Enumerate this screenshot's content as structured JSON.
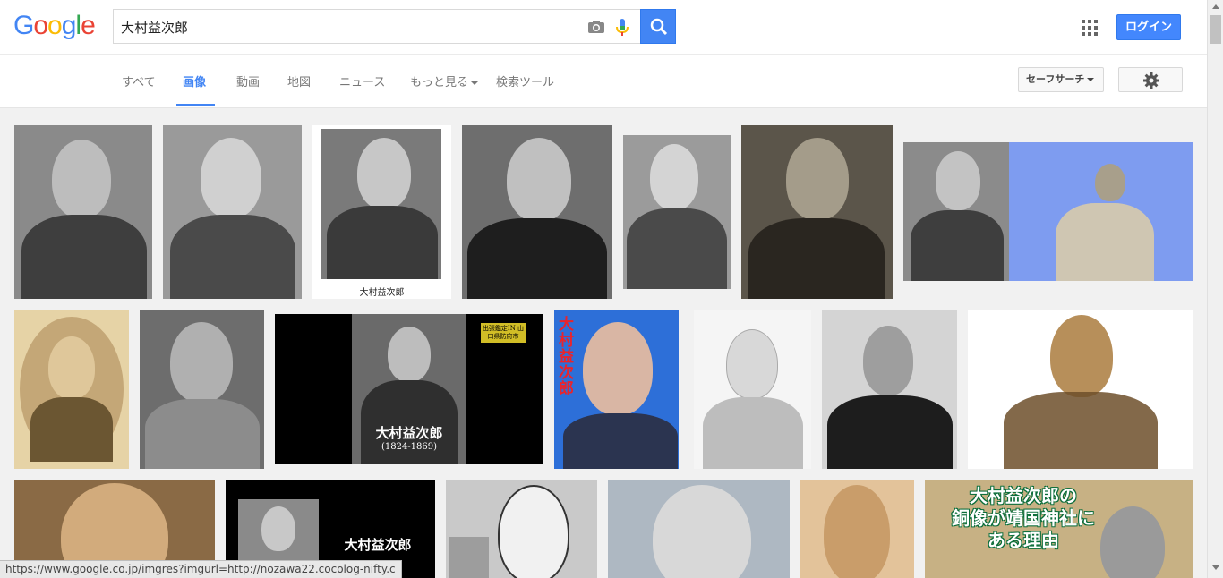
{
  "header": {
    "logo_letters": [
      {
        "ch": "G",
        "color": "#4285f4"
      },
      {
        "ch": "o",
        "color": "#ea4335"
      },
      {
        "ch": "o",
        "color": "#fbbc05"
      },
      {
        "ch": "g",
        "color": "#4285f4"
      },
      {
        "ch": "l",
        "color": "#34a853"
      },
      {
        "ch": "e",
        "color": "#ea4335"
      }
    ],
    "search_query": "大村益次郎",
    "camera_icon": "camera-icon",
    "mic_icon": "microphone-icon",
    "search_icon": "search-icon",
    "apps_icon": "apps-grid-icon",
    "login_label": "ログイン",
    "accent_color": "#4285f4"
  },
  "nav": {
    "tabs": [
      {
        "label": "すべて"
      },
      {
        "label": "画像"
      },
      {
        "label": "動画"
      },
      {
        "label": "地図"
      },
      {
        "label": "ニュース"
      },
      {
        "label": "もっと見る"
      },
      {
        "label": "検索ツール"
      }
    ],
    "active_tab": "画像",
    "safesearch_label": "セーフサーチ",
    "settings_icon": "gear-icon"
  },
  "results": {
    "image_captions": [
      "大村益次郎",
      "大村益次郎",
      "(1824-1869)",
      "大村益次郎",
      "大村益次郎",
      "大村益次郎の",
      "銅像が靖国神社に",
      "ある理由",
      "出張鑑定IN 山口県防府市"
    ]
  },
  "status_bar": {
    "url": "https://www.google.co.jp/imgres?imgurl=http://nozawa22.cocolog-nifty.c"
  }
}
